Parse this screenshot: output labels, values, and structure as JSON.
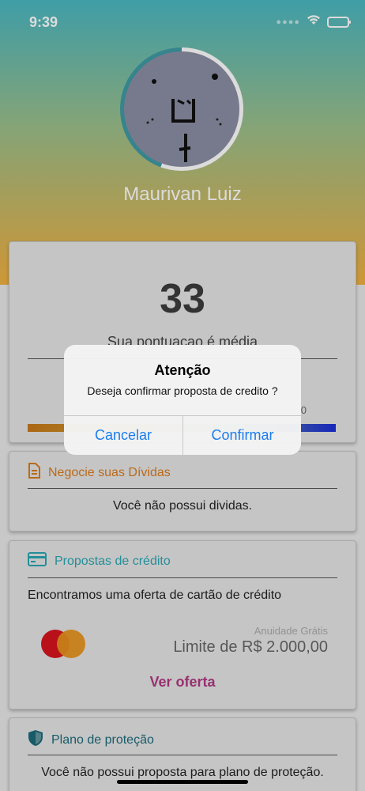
{
  "status_bar": {
    "time": "9:39"
  },
  "profile": {
    "name": "Maurivan Luiz"
  },
  "score_card": {
    "score": "33",
    "label": "Sua pontuacao é média",
    "bar_end_label": "0"
  },
  "debts_card": {
    "title": "Negocie suas Dívidas",
    "message": "Você não possui dividas."
  },
  "credit_card": {
    "title": "Propostas de crédito",
    "offer_text": "Encontramos uma oferta de cartão de crédito",
    "annuity": "Anuidade Grátis",
    "limit": "Limite de R$ 2.000,00",
    "cta": "Ver oferta"
  },
  "protection_card": {
    "title": "Plano de proteção",
    "message": "Você não possui proposta para plano de proteção."
  },
  "alert": {
    "title": "Atenção",
    "message": "Deseja confirmar proposta de credito ?",
    "cancel_label": "Cancelar",
    "confirm_label": "Confirmar"
  },
  "colors": {
    "accent_blue": "#1a7cf0",
    "debts_orange": "#d97c1e",
    "credit_teal": "#2aa7b3",
    "offer_magenta": "#b03a83",
    "protection_teal": "#1d6a7a"
  },
  "icons": {
    "wifi": "wifi-icon",
    "battery": "battery-icon",
    "document": "document-icon",
    "credit_card": "credit-card-icon",
    "shield": "shield-icon",
    "mastercard": "mastercard-logo"
  }
}
